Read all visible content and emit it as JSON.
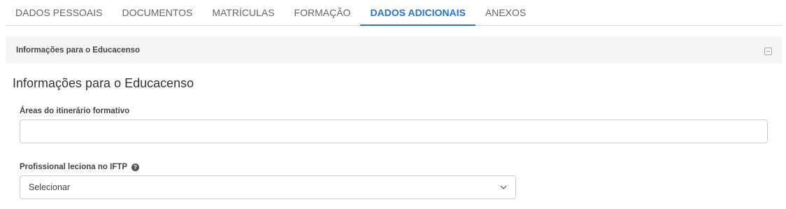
{
  "tabs": [
    {
      "label": "DADOS PESSOAIS",
      "active": false
    },
    {
      "label": "DOCUMENTOS",
      "active": false
    },
    {
      "label": "MATRÍCULAS",
      "active": false
    },
    {
      "label": "FORMAÇÃO",
      "active": false
    },
    {
      "label": "DADOS ADICIONAIS",
      "active": true
    },
    {
      "label": "ANEXOS",
      "active": false
    }
  ],
  "panel": {
    "title": "Informações para o Educacenso",
    "collapse_icon": "minus-square-icon"
  },
  "section": {
    "title": "Informações para o Educacenso"
  },
  "fields": {
    "itinerario": {
      "label": "Áreas do itinerário formativo",
      "value": ""
    },
    "iftp": {
      "label": "Profissional leciona no IFTP",
      "help_icon": "question-circle-icon",
      "value": "Selecionar"
    }
  },
  "colors": {
    "accent": "#2b74c9",
    "panel_bg": "#f5f5f5",
    "border": "#cccccc"
  }
}
